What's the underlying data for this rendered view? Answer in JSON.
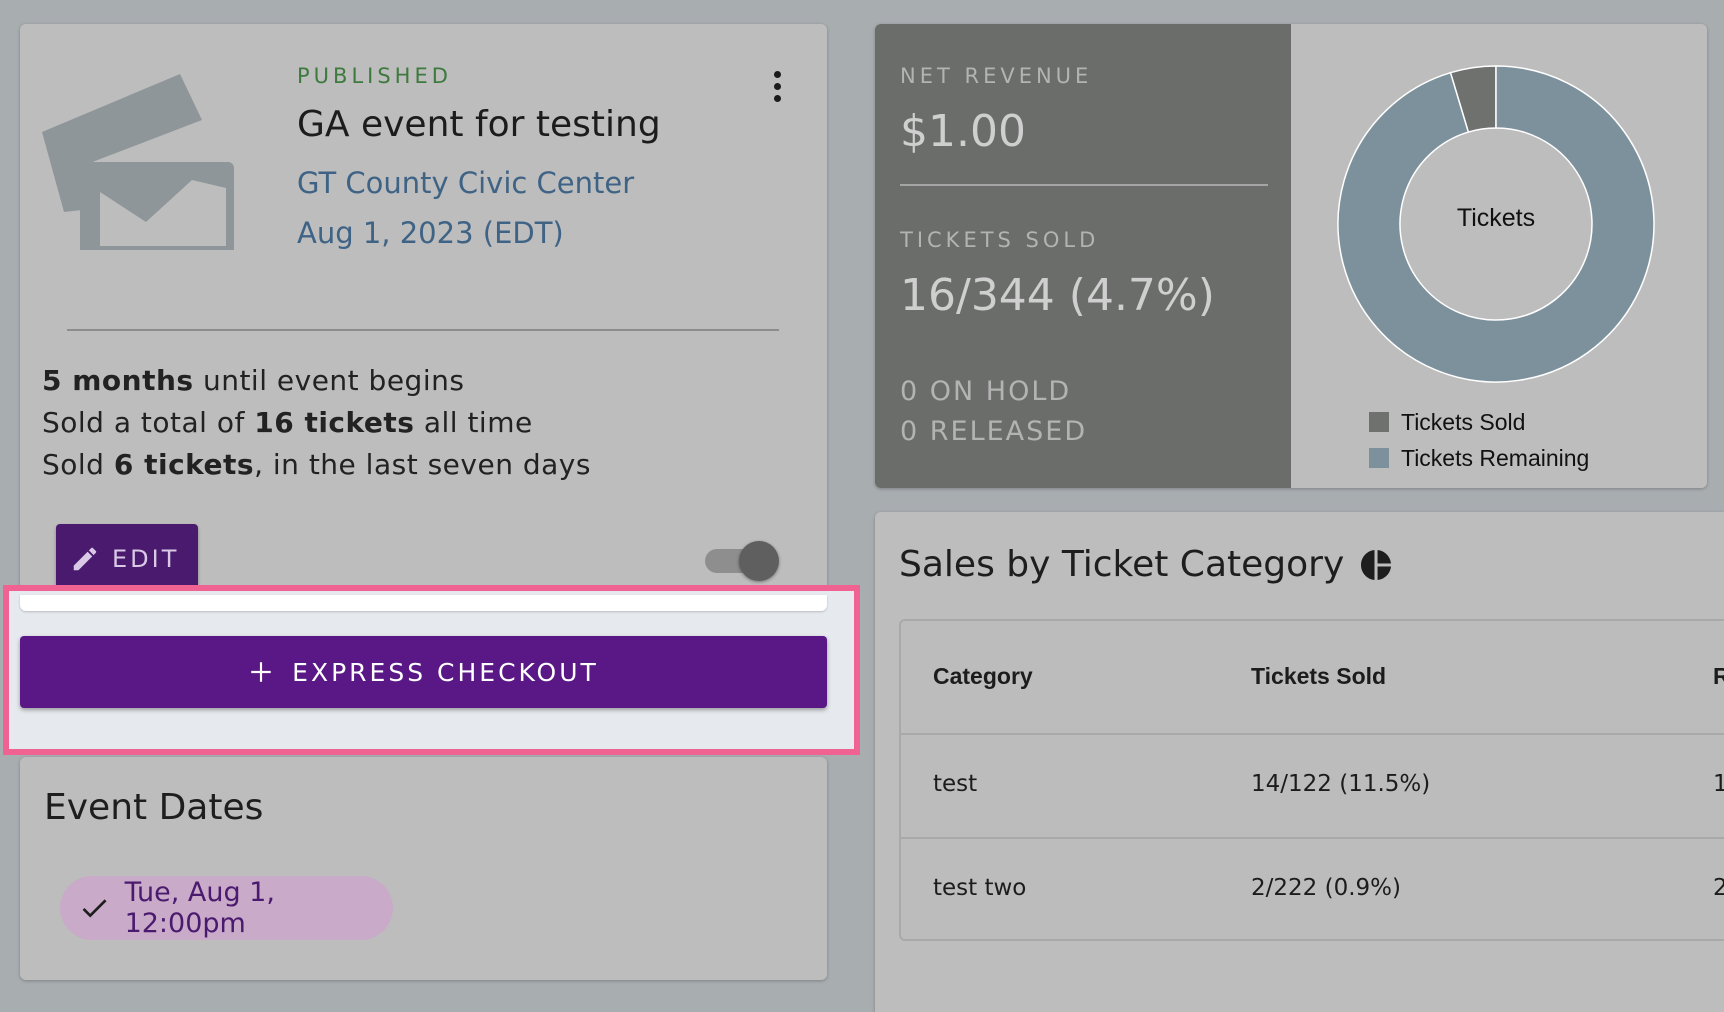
{
  "event": {
    "status": "PUBLISHED",
    "title": "GA event for testing",
    "venue": "GT County Civic Center",
    "date": "Aug 1, 2023 (EDT)",
    "stats": [
      {
        "bold": "5 months",
        "rest": " until event begins",
        "prefix": ""
      },
      {
        "prefix": "Sold a total of ",
        "bold": "16 tickets",
        "rest": " all time"
      },
      {
        "prefix": "Sold ",
        "bold": "6 tickets",
        "rest": ", in the last seven days"
      }
    ],
    "edit_label": "EDIT",
    "express_label": "EXPRESS CHECKOUT"
  },
  "event_dates": {
    "title": "Event Dates",
    "chip": "Tue, Aug 1, 12:00pm"
  },
  "revenue": {
    "net_label": "NET REVENUE",
    "net_value": "$1.00",
    "sold_label": "TICKETS SOLD",
    "sold_value": "16/344 (4.7%)",
    "on_hold": "0 ON HOLD",
    "released": "0 RELEASED"
  },
  "chart_data": {
    "type": "pie",
    "title": "",
    "center_label": "Tickets",
    "series": [
      {
        "name": "Tickets Sold",
        "value": 16,
        "color": "#6e716e"
      },
      {
        "name": "Tickets Remaining",
        "value": 328,
        "color": "#7d919d"
      }
    ]
  },
  "sales": {
    "title": "Sales by Ticket Category",
    "columns": [
      "Category",
      "Tickets Sold",
      "R"
    ],
    "rows": [
      {
        "category": "test",
        "sold": "14/122 (11.5%)",
        "rev": "1"
      },
      {
        "category": "test two",
        "sold": "2/222 (0.9%)",
        "rev": "2"
      }
    ]
  }
}
